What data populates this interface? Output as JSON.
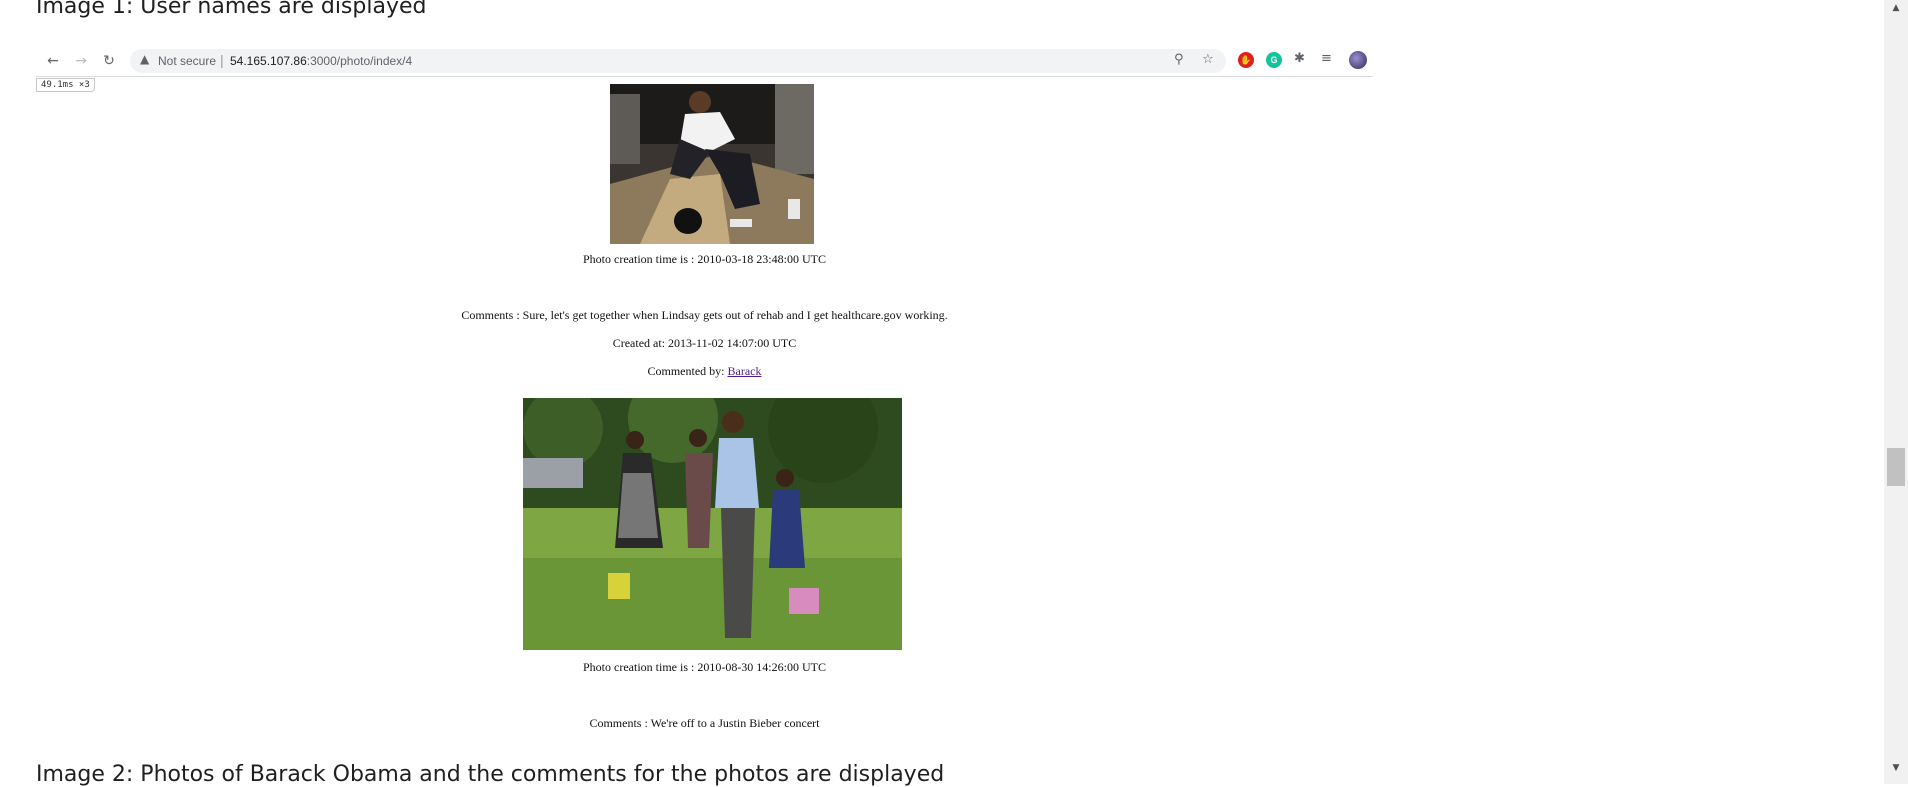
{
  "document": {
    "heading_top": "Image 1: User names are displayed",
    "heading_bottom": "Image 2: Photos of Barack Obama and the comments for the photos are displayed"
  },
  "browser": {
    "address": {
      "security_label": "Not secure",
      "url_host": "54.165.107.86",
      "url_rest": ":3000/photo/index/4"
    },
    "icons": {
      "back": "arrow-left-icon",
      "forward": "arrow-right-icon",
      "reload": "reload-icon",
      "warning": "warning-triangle-icon",
      "zoom": "magnifier-icon",
      "bookmark": "star-icon",
      "extensions": [
        "adblock-icon",
        "grammarly-icon",
        "puzzle-icon",
        "reading-list-icon"
      ],
      "profile": "profile-avatar-icon"
    },
    "timer_badge": "49.1ms ×3"
  },
  "photos": [
    {
      "image_desc_icon": "photo-bowling-icon",
      "creation_time": "Photo creation time is : 2010-03-18 23:48:00 UTC",
      "comment": {
        "text": "Comments : Sure, let's get together when Lindsay gets out of rehab and I get healthcare.gov working.",
        "created_at": "Created at: 2013-11-02 14:07:00 UTC",
        "commented_by_label": "Commented by:",
        "user": "Barack"
      }
    },
    {
      "image_desc_icon": "photo-family-walk-icon",
      "creation_time": "Photo creation time is : 2010-08-30 14:26:00 UTC",
      "comment": {
        "text": "Comments : We're off to a Justin Bieber concert"
      }
    }
  ],
  "colors": {
    "link_visited": "#551a8b",
    "adblock_red": "#e0201b",
    "grammarly_green": "#15c39a"
  }
}
